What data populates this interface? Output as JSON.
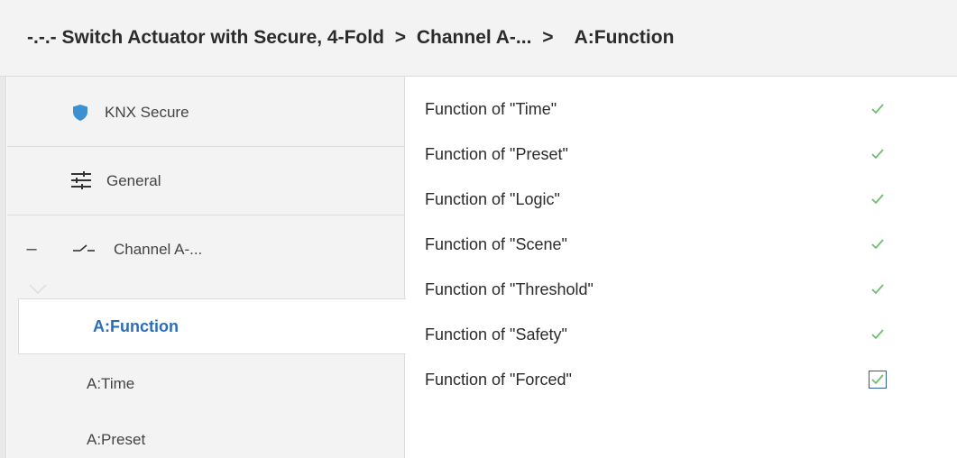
{
  "breadcrumb": {
    "device": "-.-.- Switch Actuator with Secure, 4-Fold",
    "sep1": ">",
    "channel": "Channel A-...",
    "sep2": ">",
    "current": "A:Function"
  },
  "sidebar": {
    "items": [
      {
        "label": "KNX Secure",
        "icon": "shield-icon"
      },
      {
        "label": "General",
        "icon": "sliders-icon"
      },
      {
        "label": "Channel A-...",
        "icon": "switch-contact-icon",
        "expander": "–"
      }
    ],
    "subitems": [
      {
        "label": "A:Function",
        "active": true
      },
      {
        "label": "A:Time"
      },
      {
        "label": "A:Preset"
      }
    ]
  },
  "functions": [
    {
      "label": "Function of \"Time\"",
      "checked": true
    },
    {
      "label": "Function of \"Preset\"",
      "checked": true
    },
    {
      "label": "Function of \"Logic\"",
      "checked": true
    },
    {
      "label": "Function of \"Scene\"",
      "checked": true
    },
    {
      "label": "Function of \"Threshold\"",
      "checked": true
    },
    {
      "label": "Function of \"Safety\"",
      "checked": true
    },
    {
      "label": "Function of \"Forced\"",
      "checked": true,
      "focused": true
    }
  ],
  "colors": {
    "accent": "#2a6ebb",
    "check": "#6cbf6c",
    "shield": "#3c8fd0"
  }
}
